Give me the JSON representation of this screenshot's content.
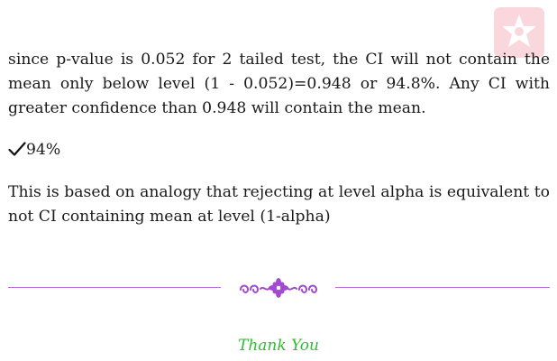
{
  "paragraphs": {
    "p1": "since p-value is 0.052 for 2 tailed test, the CI will not contain the mean only below level (1 - 0.052)=0.948 or 94.8%. Any CI with greater confidence than 0.948 will contain the mean.",
    "p2": "This is based on analogy that rejecting at level alpha is equivalent to not CI containing mean at level (1-alpha)"
  },
  "answer": {
    "value": "94%"
  },
  "footer": {
    "closing": "Thank You"
  },
  "colors": {
    "rule": "#b56ed8",
    "ornament": "#a14ad0",
    "closing": "#2bbf2b",
    "watermark": "#e0264b"
  },
  "icons": {
    "watermark": "star-badge-icon",
    "answer_marker": "checkmark-icon",
    "divider": "floral-ornament-icon"
  }
}
